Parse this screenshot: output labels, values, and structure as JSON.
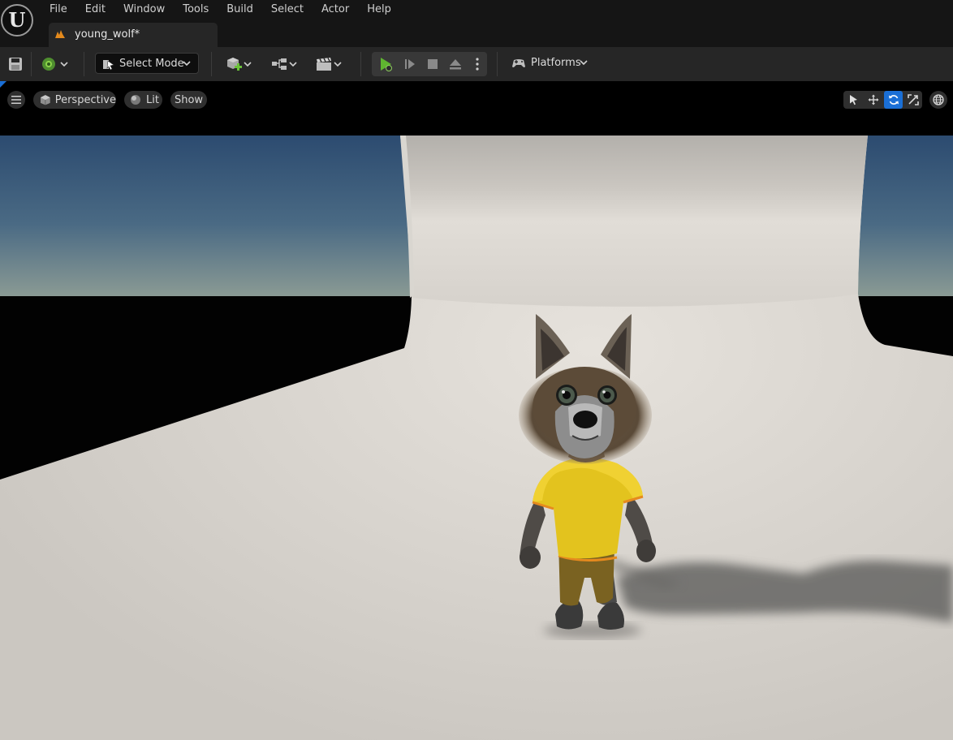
{
  "menu": [
    "File",
    "Edit",
    "Window",
    "Tools",
    "Build",
    "Select",
    "Actor",
    "Help"
  ],
  "document_tab": {
    "label": "young_wolf*"
  },
  "toolbar": {
    "select_mode_label": "Select Mode",
    "platforms_label": "Platforms"
  },
  "viewport": {
    "view_mode": "Perspective",
    "lighting_mode": "Lit",
    "show_label": "Show",
    "active_transform_tool": "rotate"
  },
  "colors": {
    "accent_blue": "#1a6fd6",
    "play_green": "#5fb530",
    "tab_icon_orange": "#e48a1c"
  }
}
